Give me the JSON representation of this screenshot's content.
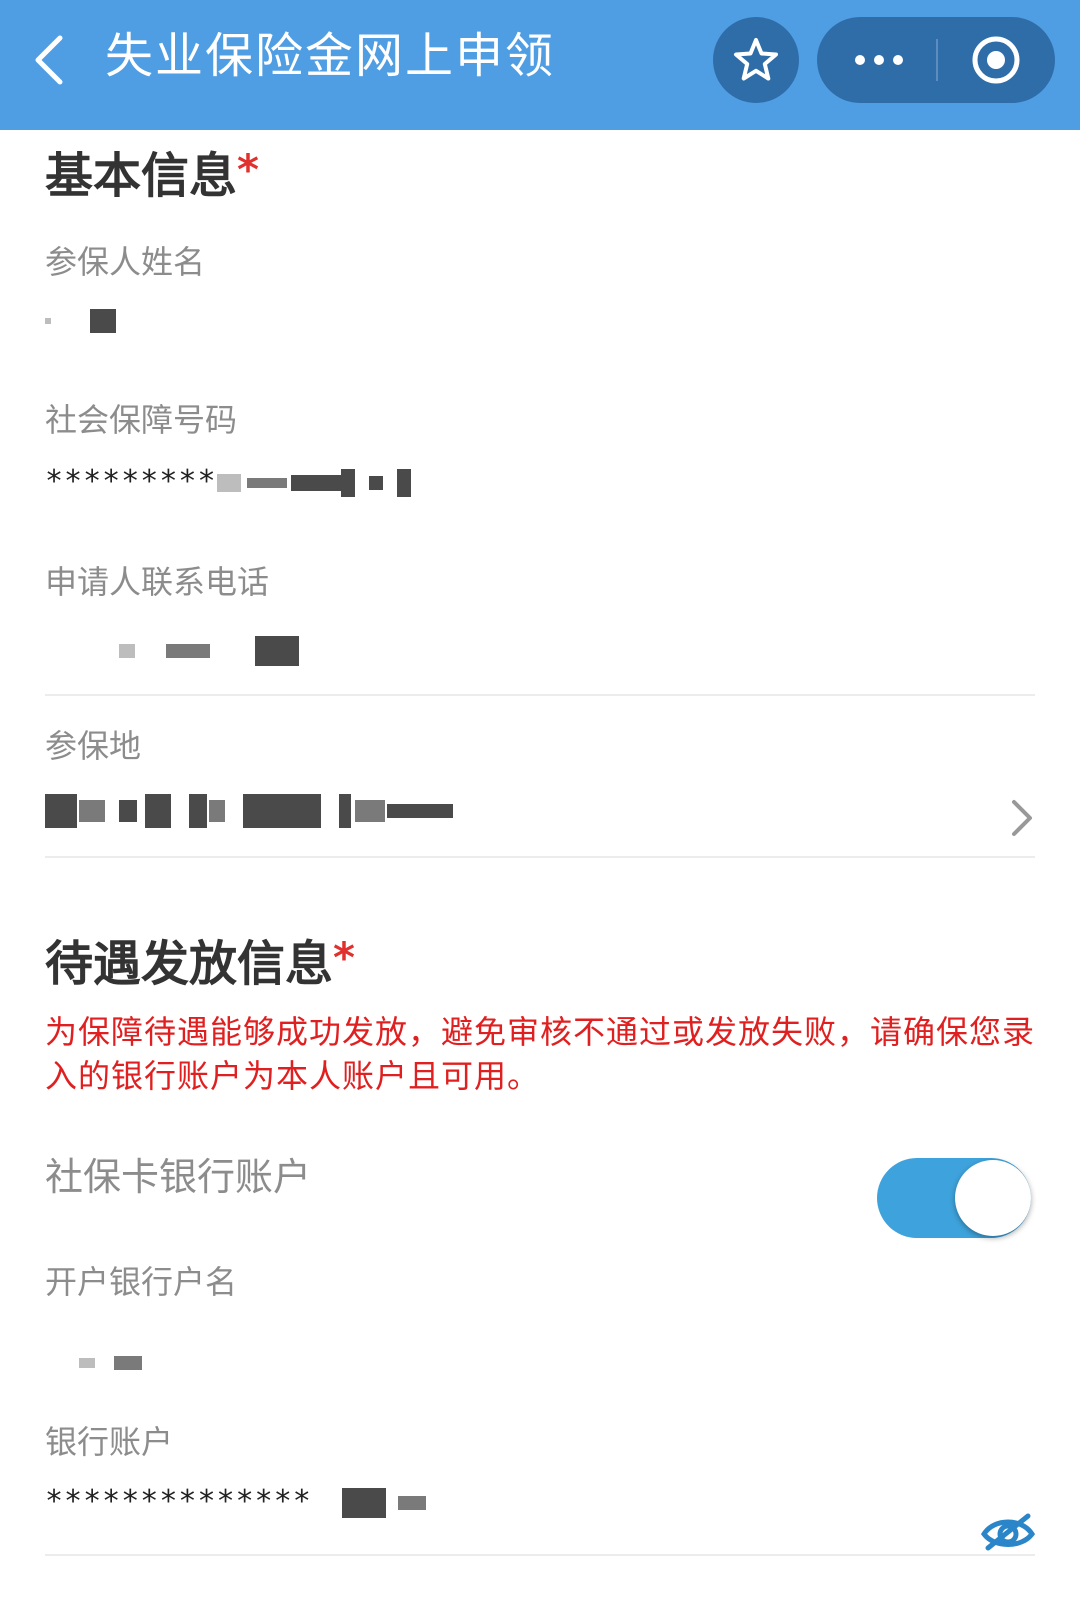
{
  "header": {
    "title": "失业保险金网上申领",
    "back_icon": "chevron-left-icon",
    "favorite_icon": "star-icon",
    "more_icon": "more-dots-icon",
    "close_icon": "target-circle-icon",
    "bg_color": "#4f9de3"
  },
  "basic_info": {
    "title": "基本信息",
    "required_mark": "*",
    "fields": [
      {
        "label": "参保人姓名",
        "value": ""
      },
      {
        "label": "社会保障号码",
        "value": "*********"
      },
      {
        "label": "申请人联系电话",
        "value": ""
      },
      {
        "label": "参保地",
        "value": ""
      }
    ]
  },
  "benefit_info": {
    "title": "待遇发放信息",
    "required_mark": "*",
    "notice": "为保障待遇能够成功发放，避免审核不通过或发放失败，请确保您录入的银行账户为本人账户且可用。",
    "social_card_toggle": {
      "label": "社保卡银行账户",
      "on": true,
      "color": "#3ea3dc"
    },
    "fields": [
      {
        "label": "开户银行户名",
        "value": ""
      },
      {
        "label": "银行账户",
        "value": "**************"
      }
    ]
  },
  "colors": {
    "required": "#e0312f",
    "notice": "#e02020"
  }
}
